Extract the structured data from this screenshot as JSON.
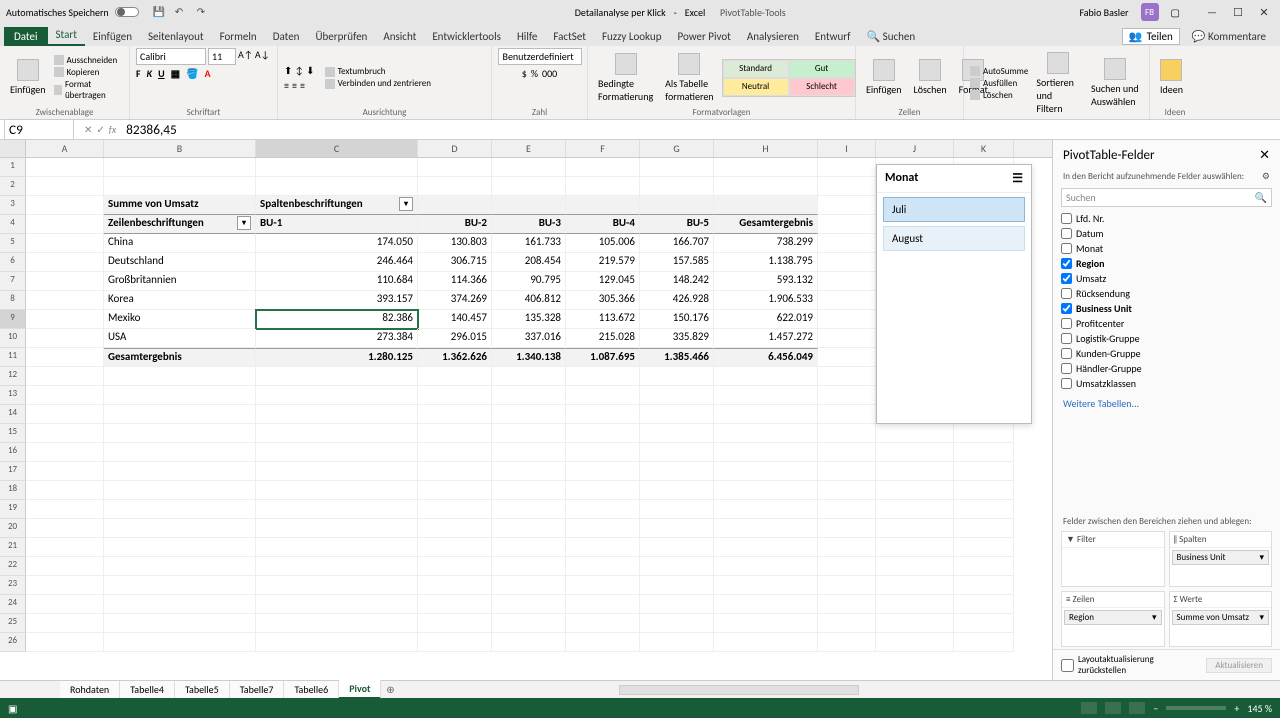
{
  "titlebar": {
    "autosave_label": "Automatisches Speichern",
    "doc_title": "Detailanalyse per Klick",
    "app_name": "Excel",
    "context_tools": "PivotTable-Tools",
    "user_name": "Fabio Basler",
    "user_initials": "FB"
  },
  "tabs": {
    "file": "Datei",
    "items": [
      "Start",
      "Einfügen",
      "Seitenlayout",
      "Formeln",
      "Daten",
      "Überprüfen",
      "Ansicht",
      "Entwicklertools",
      "Hilfe",
      "FactSet",
      "Fuzzy Lookup",
      "Power Pivot",
      "Analysieren",
      "Entwurf"
    ],
    "active": "Start",
    "search_label": "Suchen",
    "share": "Teilen",
    "comments": "Kommentare"
  },
  "ribbon": {
    "clipboard": {
      "paste": "Einfügen",
      "cut": "Ausschneiden",
      "copy": "Kopieren",
      "format_painter": "Format übertragen",
      "label": "Zwischenablage"
    },
    "font": {
      "name": "Calibri",
      "size": "11",
      "label": "Schriftart"
    },
    "align": {
      "wrap": "Textumbruch",
      "merge": "Verbinden und zentrieren",
      "label": "Ausrichtung"
    },
    "number": {
      "format": "Benutzerdefiniert",
      "label": "Zahl"
    },
    "cond": {
      "cond_fmt": "Bedingte Formatierung",
      "table": "Als Tabelle formatieren"
    },
    "styles": {
      "standard": "Standard",
      "gut": "Gut",
      "neutral": "Neutral",
      "schlecht": "Schlecht",
      "label": "Formatvorlagen"
    },
    "cells": {
      "insert": "Einfügen",
      "delete": "Löschen",
      "format": "Format",
      "label": "Zellen"
    },
    "editing": {
      "sum": "AutoSumme",
      "fill": "Ausfüllen",
      "clear": "Löschen",
      "sort": "Sortieren und Filtern",
      "find": "Suchen und Auswählen"
    },
    "ideas": {
      "label": "Ideen"
    }
  },
  "namebox": "C9",
  "formula": "82386,45",
  "columns": [
    "A",
    "B",
    "C",
    "D",
    "E",
    "F",
    "G",
    "H",
    "I",
    "J",
    "K"
  ],
  "pivot": {
    "data_label": "Summe von Umsatz",
    "col_label": "Spaltenbeschriftungen",
    "row_label": "Zeilenbeschriftungen",
    "cols": [
      "BU-1",
      "BU-2",
      "BU-3",
      "BU-4",
      "BU-5",
      "Gesamtergebnis"
    ],
    "rows": [
      {
        "label": "China",
        "v": [
          "174.050",
          "130.803",
          "161.733",
          "105.006",
          "166.707",
          "738.299"
        ]
      },
      {
        "label": "Deutschland",
        "v": [
          "246.464",
          "306.715",
          "208.454",
          "219.579",
          "157.585",
          "1.138.795"
        ]
      },
      {
        "label": "Großbritannien",
        "v": [
          "110.684",
          "114.366",
          "90.795",
          "129.045",
          "148.242",
          "593.132"
        ]
      },
      {
        "label": "Korea",
        "v": [
          "393.157",
          "374.269",
          "406.812",
          "305.366",
          "426.928",
          "1.906.533"
        ]
      },
      {
        "label": "Mexiko",
        "v": [
          "82.386",
          "140.457",
          "135.328",
          "113.672",
          "150.176",
          "622.019"
        ]
      },
      {
        "label": "USA",
        "v": [
          "273.384",
          "296.015",
          "337.016",
          "215.028",
          "335.829",
          "1.457.272"
        ]
      }
    ],
    "total_label": "Gesamtergebnis",
    "totals": [
      "1.280.125",
      "1.362.626",
      "1.340.138",
      "1.087.695",
      "1.385.466",
      "6.456.049"
    ]
  },
  "slicer": {
    "title": "Monat",
    "items": [
      "Juli",
      "August"
    ]
  },
  "fields": {
    "title": "PivotTable-Felder",
    "subtitle": "In den Bericht aufzunehmende Felder auswählen:",
    "search_ph": "Suchen",
    "list": [
      {
        "name": "Lfd. Nr.",
        "checked": false
      },
      {
        "name": "Datum",
        "checked": false
      },
      {
        "name": "Monat",
        "checked": false
      },
      {
        "name": "Region",
        "checked": true,
        "bold": true
      },
      {
        "name": "Umsatz",
        "checked": true
      },
      {
        "name": "Rücksendung",
        "checked": false
      },
      {
        "name": "Business Unit",
        "checked": true,
        "bold": true
      },
      {
        "name": "Profitcenter",
        "checked": false
      },
      {
        "name": "Logistik-Gruppe",
        "checked": false
      },
      {
        "name": "Kunden-Gruppe",
        "checked": false
      },
      {
        "name": "Händler-Gruppe",
        "checked": false
      },
      {
        "name": "Umsatzklassen",
        "checked": false
      }
    ],
    "more": "Weitere Tabellen...",
    "drag_hint": "Felder zwischen den Bereichen ziehen und ablegen:",
    "areas": {
      "filter": "Filter",
      "columns": "Spalten",
      "columns_item": "Business Unit",
      "rows": "Zeilen",
      "rows_item": "Region",
      "values": "Werte",
      "values_item": "Summe von Umsatz"
    },
    "defer": "Layoutaktualisierung zurückstellen",
    "update": "Aktualisieren"
  },
  "sheets": {
    "tabs": [
      "Rohdaten",
      "Tabelle4",
      "Tabelle5",
      "Tabelle7",
      "Tabelle6",
      "Pivot"
    ],
    "active": "Pivot"
  },
  "status": {
    "zoom": "145 %"
  }
}
